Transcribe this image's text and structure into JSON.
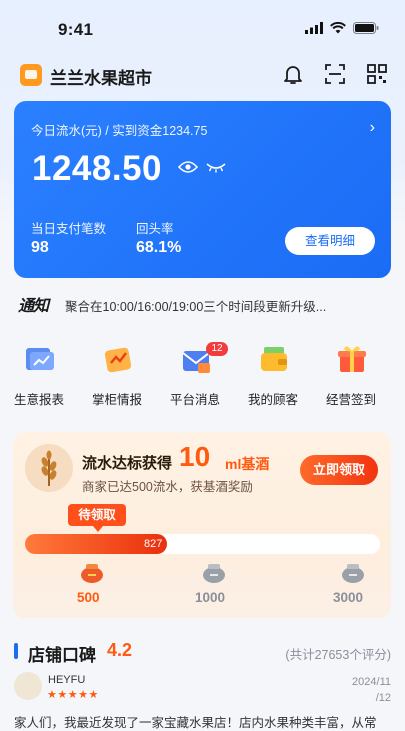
{
  "status_bar": {
    "time": "9:41"
  },
  "header": {
    "shop_name": "兰兰水果超市"
  },
  "revenue_card": {
    "subtitle": "今日流水(元) / 实到资金1234.75",
    "amount": "1248.50",
    "stat1_label": "当日支付笔数",
    "stat1_value": "98",
    "stat2_label": "回头率",
    "stat2_value": "68.1%",
    "detail_button": "查看明细",
    "accent": "#1a6cf5"
  },
  "notice": {
    "tag": "通知",
    "text": "聚合在10:00/16:00/19:00三个时间段更新升级..."
  },
  "quick_actions": [
    {
      "label": "生意报表",
      "icon": "report-icon"
    },
    {
      "label": "掌柜情报",
      "icon": "intel-icon"
    },
    {
      "label": "平台消息",
      "icon": "message-icon",
      "badge": "12"
    },
    {
      "label": "我的顾客",
      "icon": "wallet-icon"
    },
    {
      "label": "经营签到",
      "icon": "gift-icon"
    }
  ],
  "promo": {
    "title": "流水达标获得",
    "reward_amount": "10",
    "reward_unit": "ml基酒",
    "description": "商家已达500流水，获基酒奖励",
    "claim_button": "立即领取",
    "pending_label": "待领取",
    "progress_value": "827",
    "progress_fraction": 0.4,
    "milestones": [
      {
        "value": "500",
        "reached": true
      },
      {
        "value": "1000",
        "reached": false
      },
      {
        "value": "3000",
        "reached": false
      }
    ]
  },
  "rating": {
    "title": "店铺口碑",
    "score": "4.2",
    "count_text": "(共计27653个评分)"
  },
  "review": {
    "user": "HEYFU",
    "stars": "★★★★★",
    "date_line1": "2024/11",
    "date_line2": "/12",
    "text": "家人们，我最近发现了一家宝藏水果店！店内水果种类丰富，从常"
  }
}
